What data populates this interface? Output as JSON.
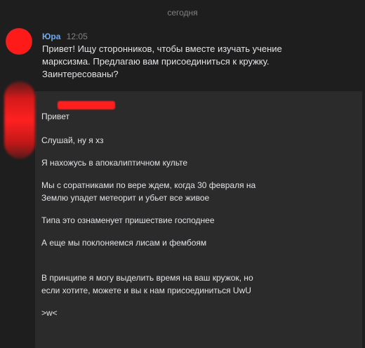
{
  "chat": {
    "date_separator": "сегодня",
    "message1": {
      "author": "Юра",
      "time": "12:05",
      "lines": [
        "Привет! Ищу сторонников, чтобы вместе изучать учение",
        "марксизма. Предлагаю вам присоединиться к кружку.",
        "Заинтересованы?"
      ]
    },
    "message2": {
      "paragraphs": [
        [
          "Привет"
        ],
        [
          "Слушай, ну я хз"
        ],
        [
          "Я нахожусь в апокалиптичном культе"
        ],
        [
          "Мы с соратниками по вере ждем, когда 30 февраля на",
          "Землю упадет метеорит и убьет все живое"
        ],
        [
          "Типа это ознаменует пришествие господнее"
        ],
        [
          "А еще мы поклоняемся лисам и фембоям"
        ],
        [
          "В принципе я могу выделить время на ваш кружок, но",
          "если хотите, можете и вы к нам присоединиться UwU"
        ],
        [
          ">w<"
        ]
      ]
    }
  },
  "colors": {
    "background": "#1e1e1f",
    "panel": "#2b2b2c",
    "author": "#71aaeb",
    "text": "#e1e3e6",
    "muted": "#828282",
    "redaction": "#ff1f1f"
  }
}
